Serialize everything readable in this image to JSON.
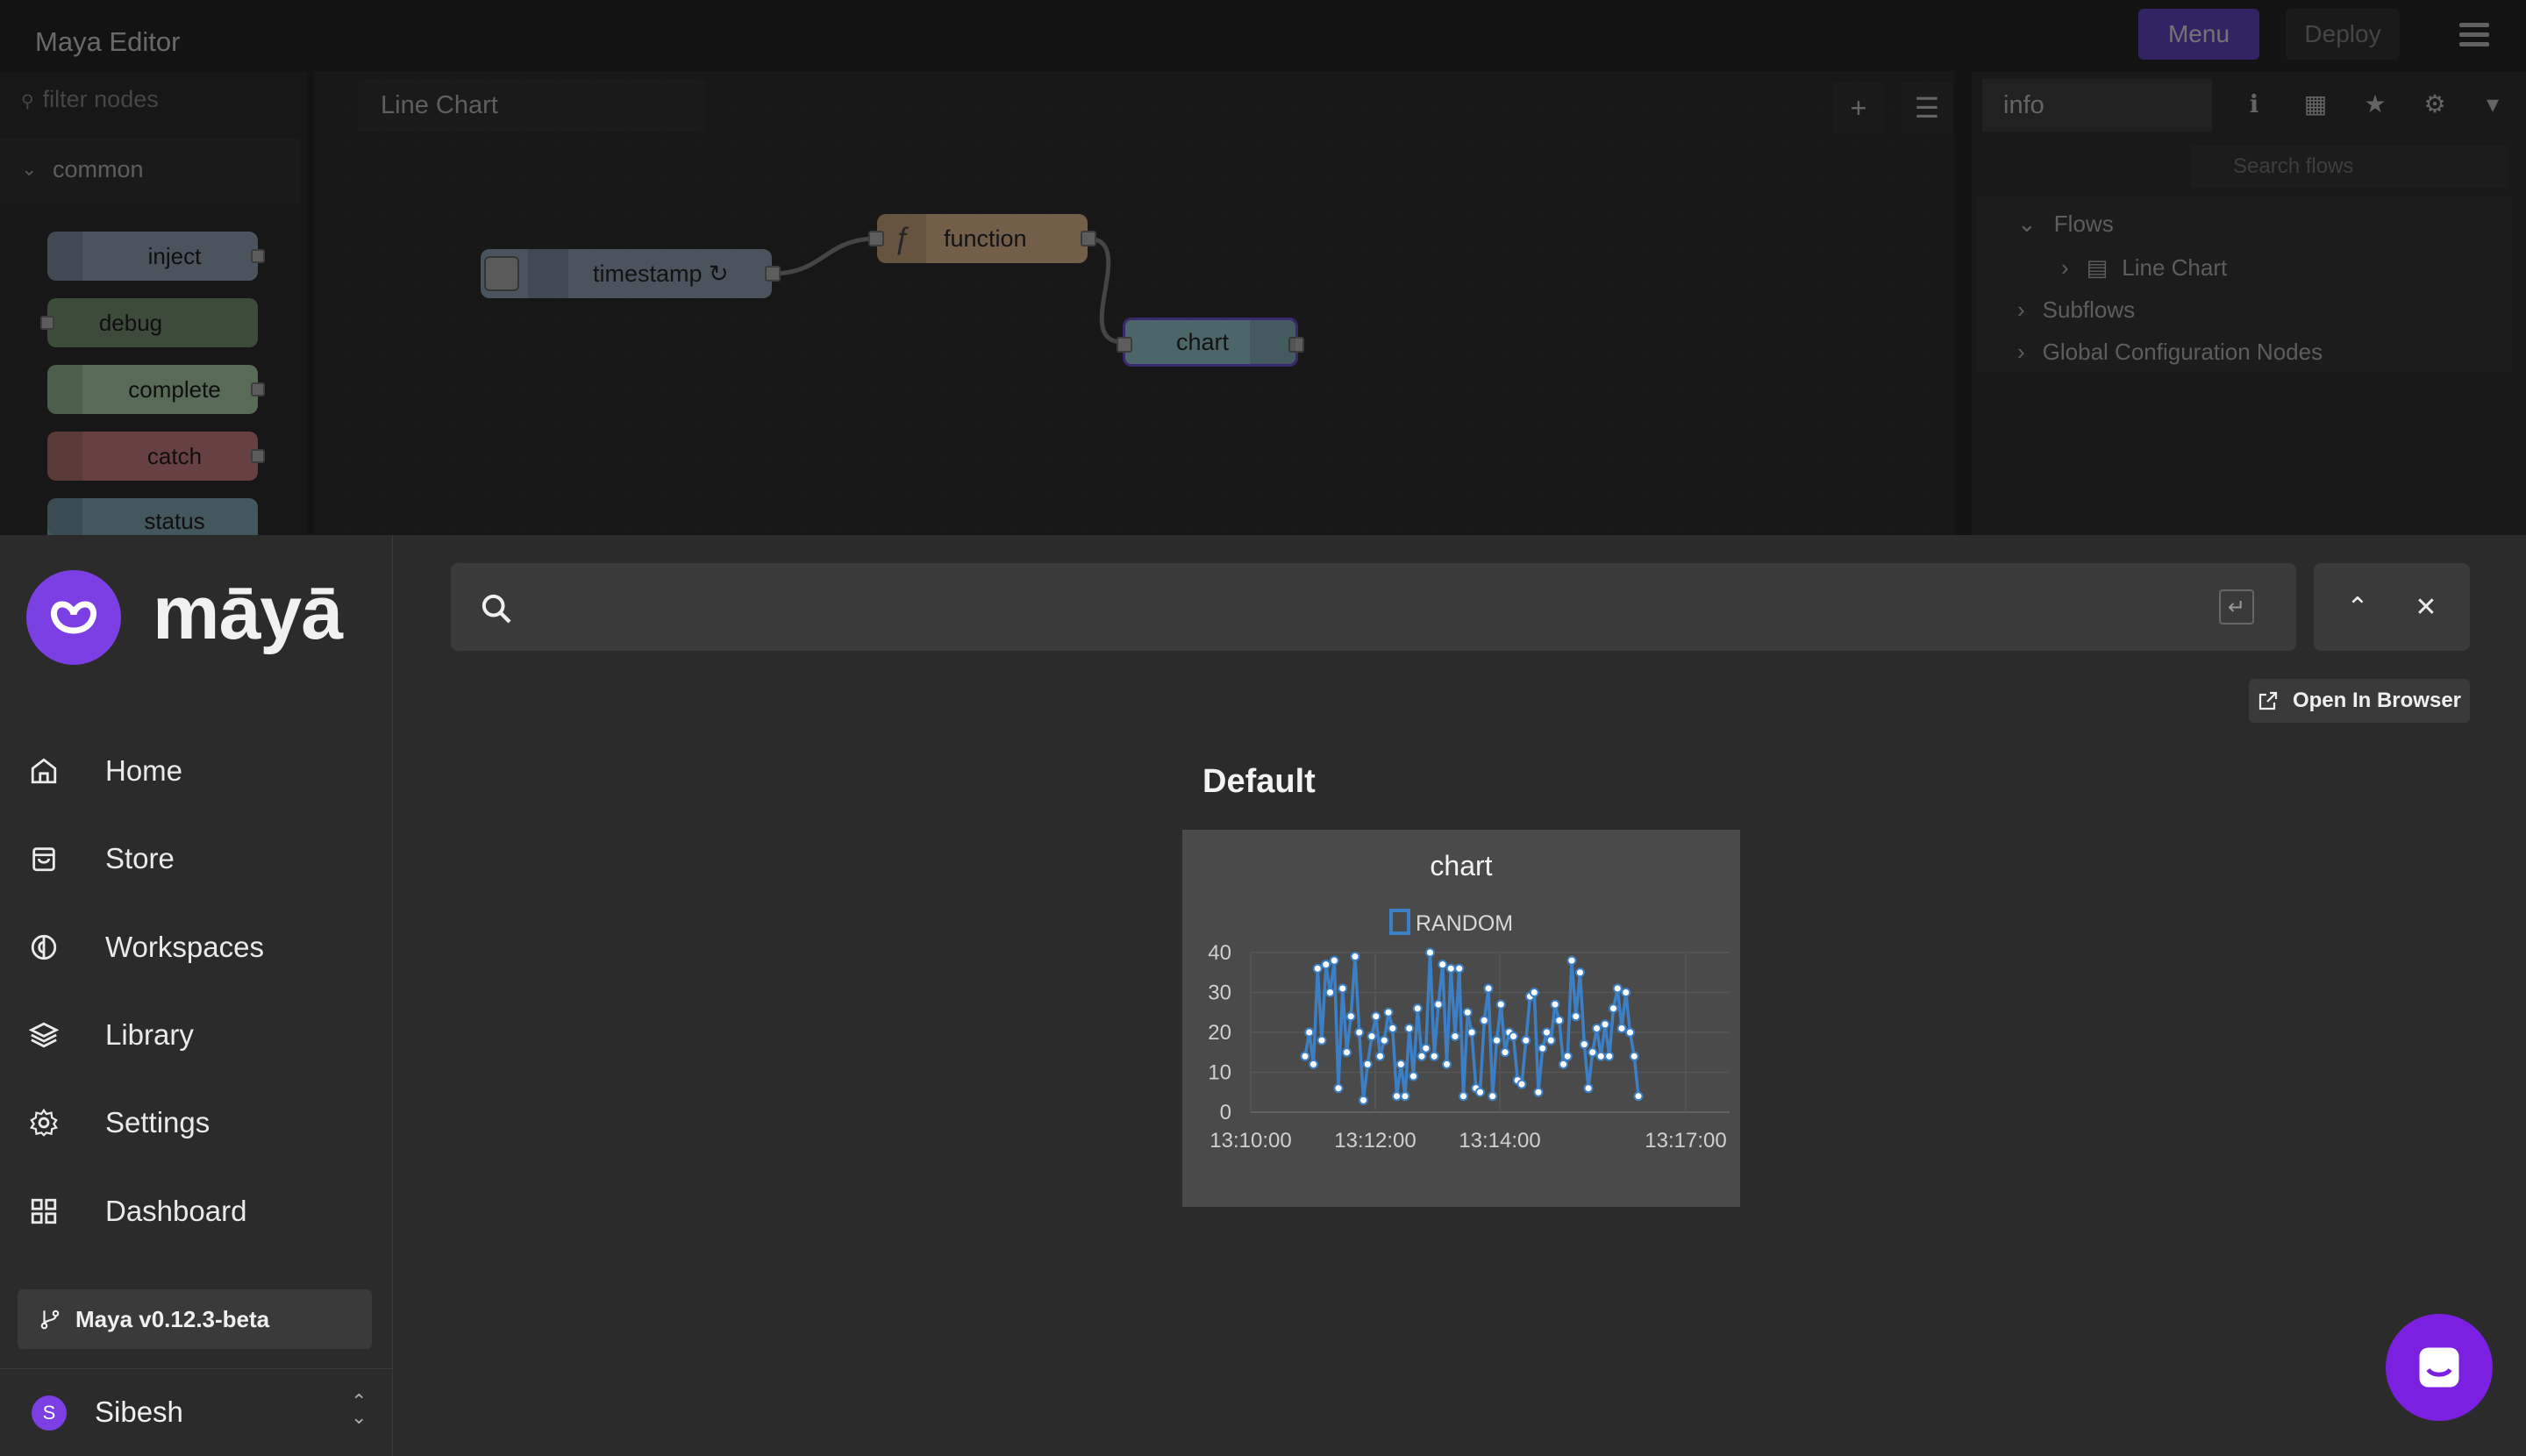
{
  "editor": {
    "title": "Maya Editor",
    "menu_label": "Menu",
    "deploy_label": "Deploy",
    "palette_filter_placeholder": "filter nodes",
    "palette_category": "common",
    "palette_nodes": [
      "inject",
      "debug",
      "complete",
      "catch",
      "status"
    ],
    "flow_tab": "Line Chart",
    "flow_nodes": {
      "timestamp": "timestamp ↻",
      "function": "function",
      "chart": "chart"
    },
    "sidebar_tab": "info",
    "sidebar_search_placeholder": "Search flows",
    "tree": {
      "flows": "Flows",
      "line_chart": "Line Chart",
      "subflows": "Subflows",
      "global_config": "Global Configuration Nodes"
    }
  },
  "brand": {
    "name": "māyā",
    "accent": "#7b3fe4"
  },
  "nav": {
    "items": [
      {
        "label": "Home",
        "icon": "home-icon"
      },
      {
        "label": "Store",
        "icon": "store-icon"
      },
      {
        "label": "Workspaces",
        "icon": "workspaces-icon"
      },
      {
        "label": "Library",
        "icon": "library-icon"
      },
      {
        "label": "Settings",
        "icon": "settings-icon"
      },
      {
        "label": "Dashboard",
        "icon": "dashboard-icon"
      }
    ],
    "version": "Maya v0.12.3-beta",
    "user": {
      "initial": "S",
      "name": "Sibesh"
    }
  },
  "main": {
    "open_in_browser": "Open In Browser",
    "dashboard_title": "Default"
  },
  "chart_data": {
    "type": "line",
    "title": "chart",
    "series": [
      {
        "name": "RANDOM",
        "color": "#3d7fc4",
        "values": [
          14,
          20,
          12,
          36,
          18,
          37,
          30,
          38,
          6,
          31,
          15,
          24,
          39,
          20,
          3,
          12,
          19,
          24,
          14,
          18,
          25,
          21,
          4,
          12,
          4,
          21,
          9,
          26,
          14,
          16,
          40,
          14,
          27,
          37,
          12,
          36,
          19,
          36,
          4,
          25,
          20,
          6,
          5,
          23,
          31,
          4,
          18,
          27,
          15,
          20,
          19,
          8,
          7,
          18,
          29,
          30,
          5,
          16,
          20,
          18,
          27,
          23,
          12,
          14,
          38,
          24,
          35,
          17,
          6,
          15,
          21,
          14,
          22,
          14,
          26,
          31,
          21,
          30,
          20,
          14,
          4
        ]
      }
    ],
    "x_ticks": [
      "13:10:00",
      "13:12:00",
      "13:14:00",
      "13:17:00"
    ],
    "y_ticks": [
      "0",
      "10",
      "20",
      "30",
      "40"
    ],
    "ylim": [
      0,
      40
    ],
    "legend": "top-center",
    "grid": true
  }
}
